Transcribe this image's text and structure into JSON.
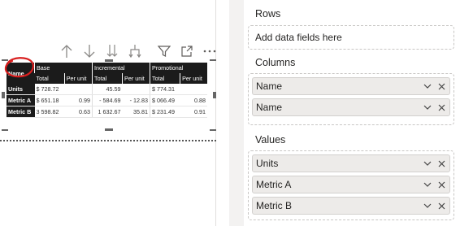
{
  "toolbar_icons": [
    "arrow-up-icon",
    "arrow-down-icon",
    "double-arrow-down-icon",
    "expand-down-icon",
    "filter-icon",
    "focus-mode-icon",
    "more-options-icon"
  ],
  "matrix": {
    "corner": "Name",
    "groups": [
      "Base",
      "Incremental",
      "Promotional"
    ],
    "subheaders": [
      "Total",
      "Per unit",
      "Total",
      "Per unit",
      "Total",
      "Per unit"
    ],
    "rows": [
      {
        "label": "Units",
        "cells": [
          "$ 728.72",
          "",
          "45.59",
          "",
          "$ 774.31",
          ""
        ]
      },
      {
        "label": "Metric A",
        "cells": [
          "$ 651.18",
          "0.99",
          "- 584.69",
          "- 12.83",
          "$ 066.49",
          "0.88"
        ]
      },
      {
        "label": "Metric B",
        "cells": [
          "3 598.82",
          "0.63",
          "1 632.67",
          "35.81",
          "$ 231.49",
          "0.91"
        ]
      }
    ]
  },
  "panel": {
    "rows": {
      "title": "Rows",
      "placeholder": "Add data fields here"
    },
    "columns": {
      "title": "Columns",
      "fields": [
        "Name",
        "Name"
      ]
    },
    "values": {
      "title": "Values",
      "fields": [
        "Units",
        "Metric A",
        "Metric B"
      ]
    }
  },
  "colors": {
    "annotation": "#d91e1e",
    "matrix_header": "#1b1b1b",
    "pill_bg": "#edebe9"
  }
}
